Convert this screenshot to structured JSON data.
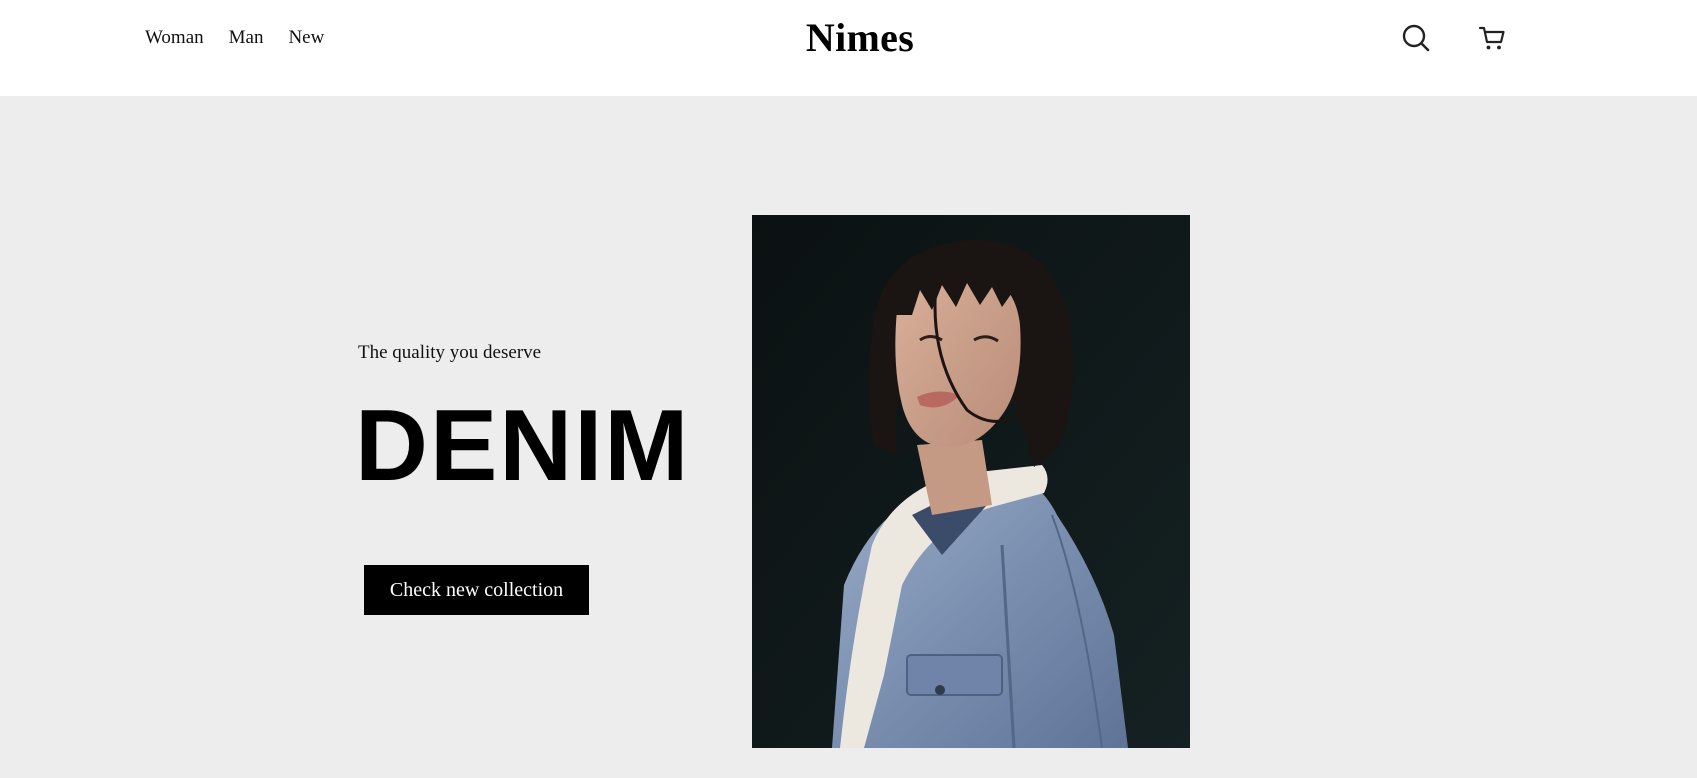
{
  "header": {
    "nav": [
      {
        "label": "Woman"
      },
      {
        "label": "Man"
      },
      {
        "label": "New"
      }
    ],
    "brand": "Nimes",
    "icons": [
      "search-icon",
      "cart-icon"
    ]
  },
  "hero": {
    "tagline": "The quality you deserve",
    "headline": "DENIM",
    "cta_label": "Check new collection",
    "image": "woman-in-denim-jacket-photo"
  },
  "colors": {
    "header_bg": "#ffffff",
    "hero_bg": "#ededed",
    "button_bg": "#000000",
    "button_text": "#ffffff",
    "photo_bg": "#0f1718",
    "denim": "#7f93b3"
  }
}
